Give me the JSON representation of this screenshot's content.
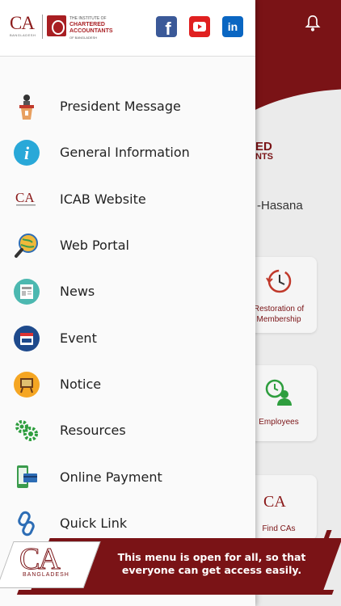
{
  "header": {
    "ca_mark": "CA",
    "ca_sub": "BANGLADESH",
    "institute_line1": "THE INSTITUTE OF",
    "institute_line2": "CHARTERED ACCOUNTANTS",
    "institute_line3": "OF BANGLADESH",
    "social": [
      {
        "name": "facebook",
        "glyph": "f",
        "color": "#3b5998"
      },
      {
        "name": "youtube",
        "glyph": "▶",
        "color": "#e02020"
      },
      {
        "name": "linkedin",
        "glyph": "in",
        "color": "#0a66c2"
      }
    ]
  },
  "background": {
    "logo_partial_line1": "ED",
    "logo_partial_line2": "NTS",
    "name_partial": "-Hasana",
    "cards": [
      {
        "label": "Restoration of Membership"
      },
      {
        "label": "Employees"
      },
      {
        "label": "Find CAs"
      }
    ]
  },
  "menu": [
    {
      "label": "President Message",
      "icon": "podium-icon"
    },
    {
      "label": "General Information",
      "icon": "info-icon"
    },
    {
      "label": "ICAB Website",
      "icon": "ca-logo-icon"
    },
    {
      "label": "Web Portal",
      "icon": "globe-search-icon"
    },
    {
      "label": "News",
      "icon": "newspaper-icon"
    },
    {
      "label": "Event",
      "icon": "calendar-icon"
    },
    {
      "label": "Notice",
      "icon": "notice-board-icon"
    },
    {
      "label": "Resources",
      "icon": "gears-icon"
    },
    {
      "label": "Online Payment",
      "icon": "payment-icon"
    },
    {
      "label": "Quick Link",
      "icon": "link-icon"
    }
  ],
  "promo": {
    "text": "This menu is open for all, so that everyone can get access easily.",
    "logo_ca": "CA",
    "logo_sub": "BANGLADESH"
  },
  "colors": {
    "brand": "#7a1316",
    "info": "#29a8d8"
  }
}
